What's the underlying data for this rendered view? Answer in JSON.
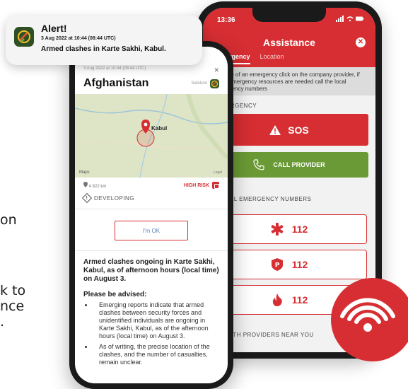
{
  "edge_text": {
    "line_a": "on",
    "line_b1": "k to",
    "line_b2": "nce",
    "line_b3": "."
  },
  "notification": {
    "title": "Alert!",
    "timestamp": "3 Aug 2022 at 10:44 (08:44 UTC)",
    "message": "Armed clashes in Karte Sakhi, Kabul."
  },
  "back_phone": {
    "status_time": "13:36",
    "status_icons": "▲ ▲",
    "header_title": "Assistance",
    "close_icon": "✕",
    "tabs": [
      {
        "label": "Emergency"
      },
      {
        "label": "Location"
      }
    ],
    "info_text": "In case of an emergency click on the company provider, if local emergency resources are needed call the local emergency numbers",
    "section_provider": "EMERGENCY",
    "sos_label": "SOS",
    "call_label": "CALL PROVIDER",
    "section_numbers": "LOCAL EMERGENCY NUMBERS",
    "numbers": [
      {
        "icon": "medical-icon",
        "value": "112"
      },
      {
        "icon": "police-icon",
        "value": "112"
      },
      {
        "icon": "fire-icon",
        "value": "112"
      }
    ],
    "footer": "HEALTH PROVIDERS NEAR YOU"
  },
  "front_phone": {
    "meta_time": "3 Aug 2022 at 10:44 (08:44 UTC)",
    "close": "✕",
    "title": "Afghanistan",
    "brand": "Safeture",
    "map": {
      "pin_label": "Kabul",
      "maps_label": "Maps",
      "legal": "Legal"
    },
    "distance": "4 822 km",
    "risk_label": "HIGH RISK",
    "status": "DEVELOPING",
    "ok_button": "I'm OK",
    "headline": "Armed clashes ongoing in Karte Sakhi, Kabul, as of afternoon hours (local time) on August 3.",
    "advised_heading": "Please be advised:",
    "bullets": [
      "Emerging reports indicate that armed clashes between security forces and unidentified individuals are ongoing in Karte Sakhi, Kabul, as of the afternoon hours (local time) on August 3.",
      "As of writing, the precise location of the clashes, and the number of casualties, remain unclear."
    ]
  },
  "colors": {
    "brand_red": "#d62e32",
    "call_green": "#6a9a35",
    "link_blue": "#5a7fb8"
  }
}
